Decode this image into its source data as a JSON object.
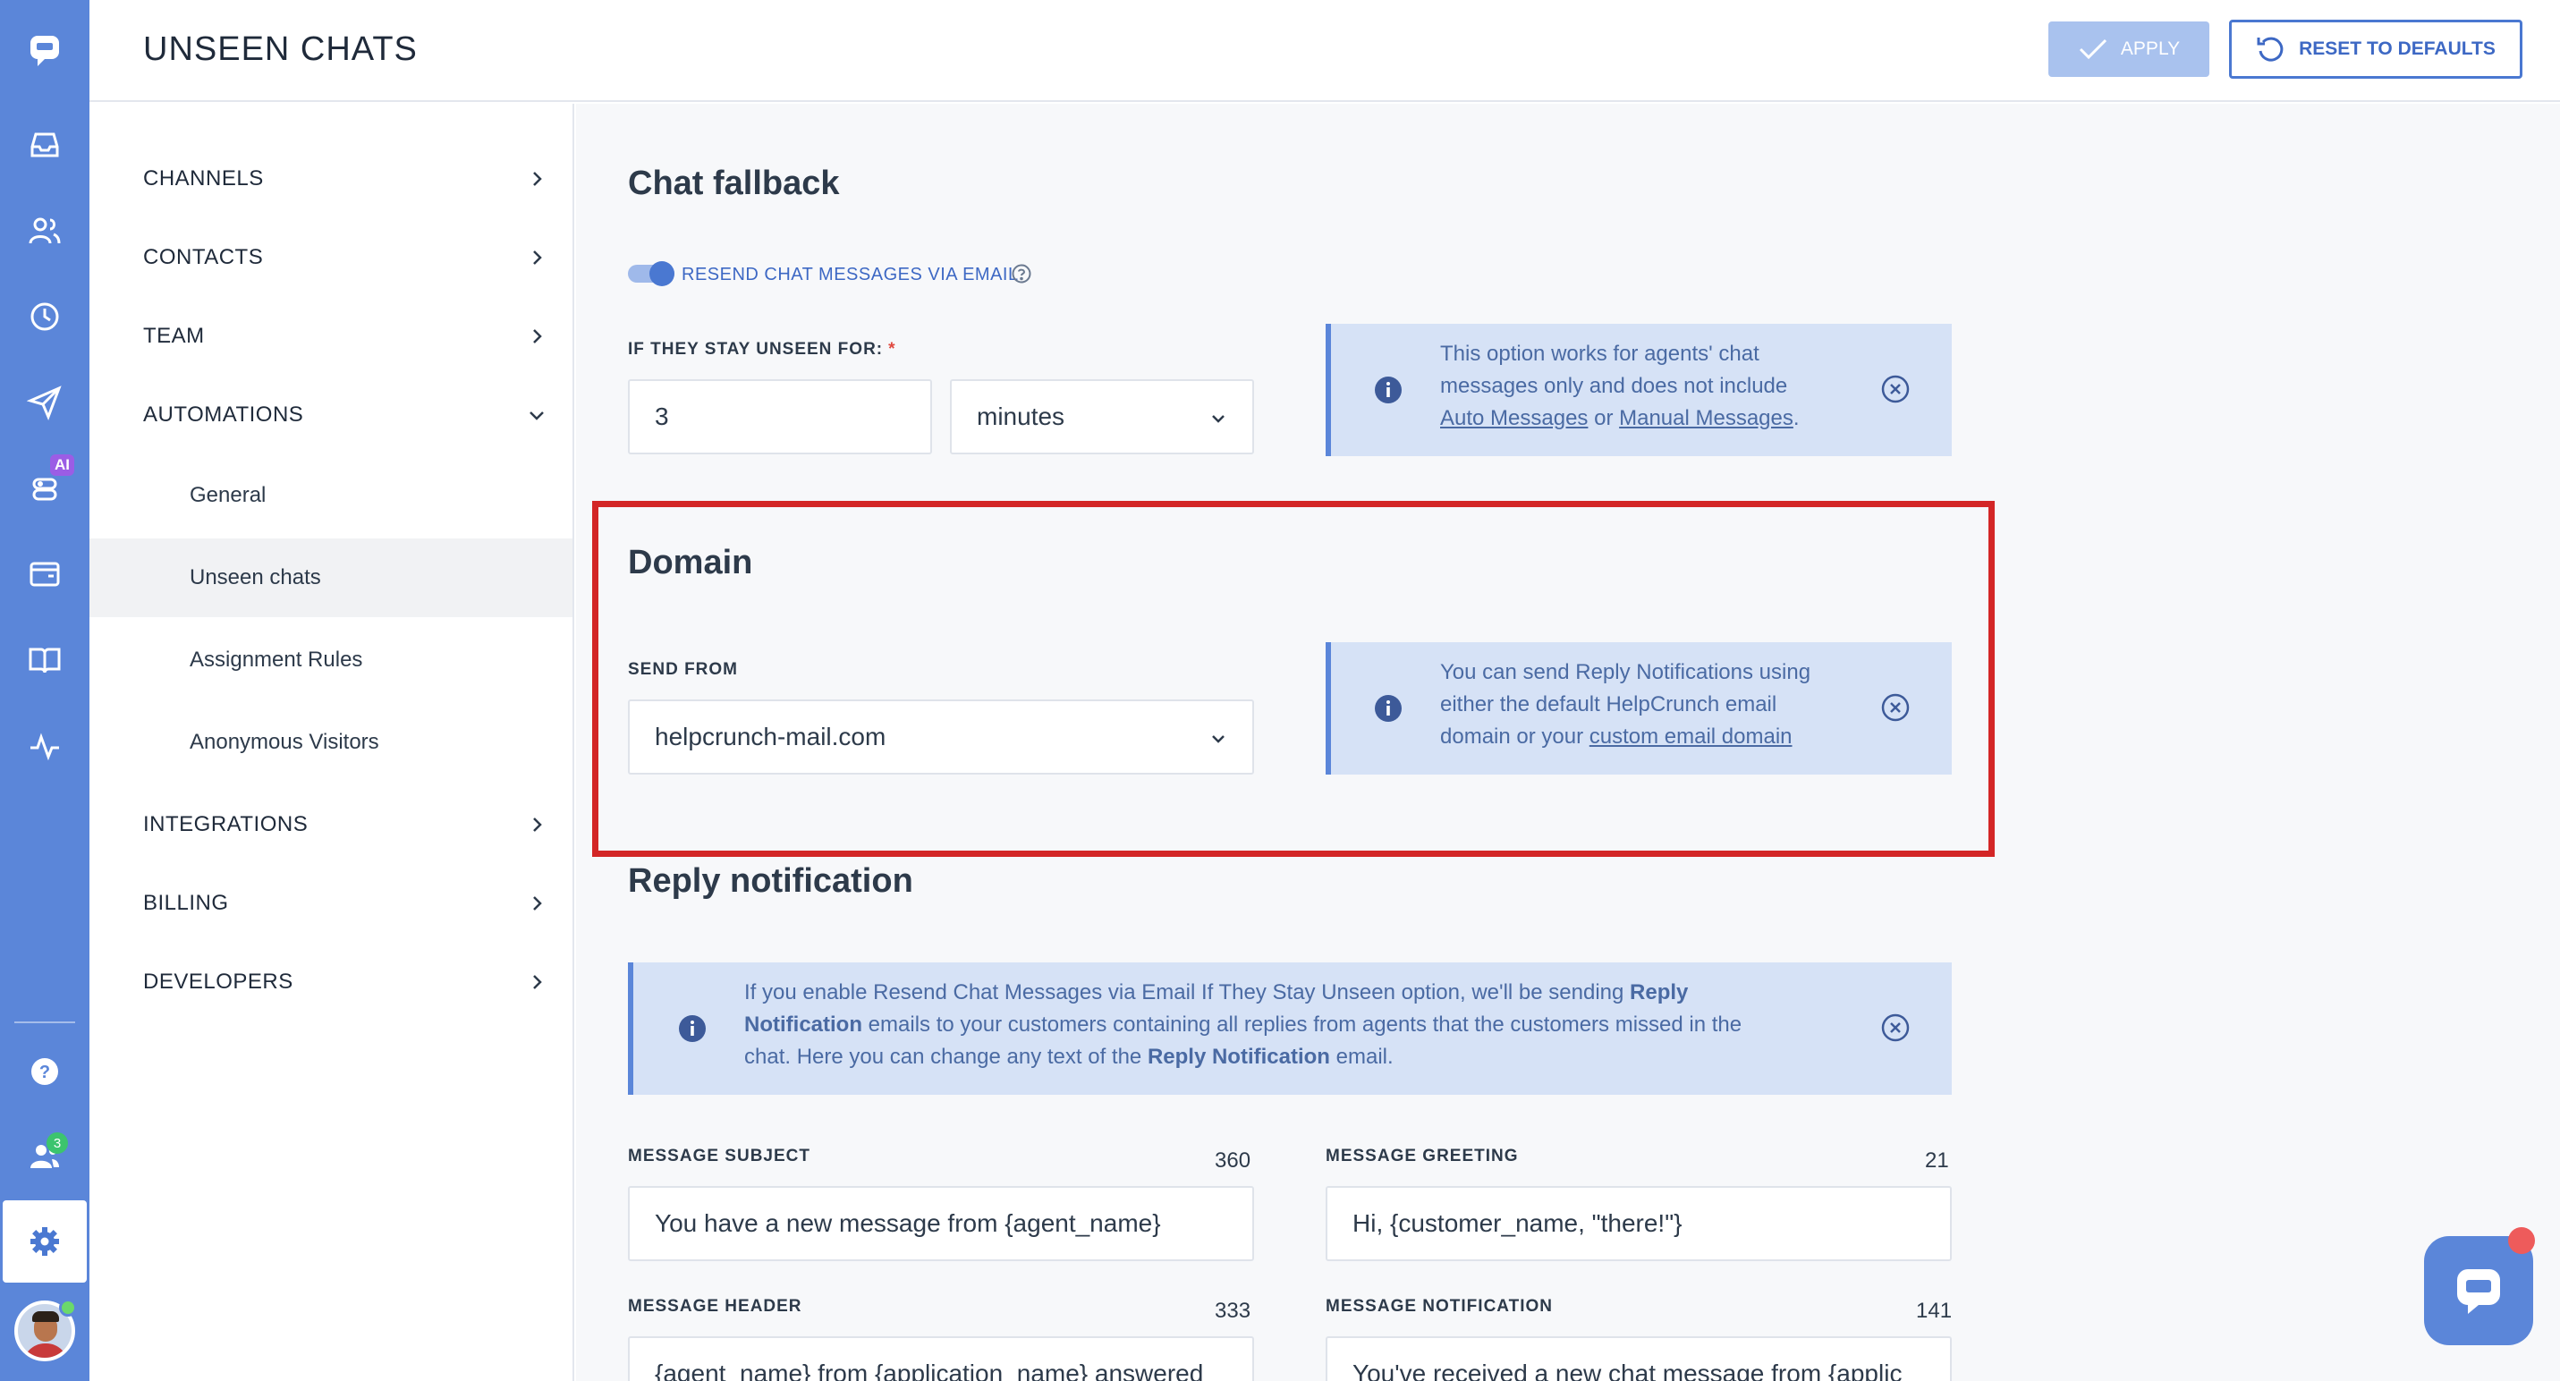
{
  "header": {
    "title": "UNSEEN CHATS",
    "apply_label": "APPLY",
    "reset_label": "RESET TO DEFAULTS"
  },
  "rail": {
    "icons": [
      "chat-logo-icon",
      "inbox-icon",
      "contacts-icon",
      "history-icon",
      "send-icon",
      "ai-bot-icon",
      "knowledge-card-icon",
      "book-icon",
      "activity-icon",
      "help-icon",
      "team-icon",
      "settings-icon"
    ],
    "ai_badge": "AI",
    "team_count": "3"
  },
  "sidebar": {
    "items": [
      {
        "label": "CHANNELS"
      },
      {
        "label": "CONTACTS"
      },
      {
        "label": "TEAM"
      },
      {
        "label": "AUTOMATIONS"
      }
    ],
    "sub_items": [
      {
        "label": "General"
      },
      {
        "label": "Unseen chats"
      },
      {
        "label": "Assignment Rules"
      },
      {
        "label": "Anonymous Visitors"
      }
    ],
    "bottom_items": [
      {
        "label": "INTEGRATIONS"
      },
      {
        "label": "BILLING"
      },
      {
        "label": "DEVELOPERS"
      }
    ]
  },
  "chat_fallback": {
    "heading": "Chat fallback",
    "toggle_label": "RESEND CHAT MESSAGES VIA EMAIL",
    "toggle_on": true,
    "unseen_label": "IF THEY STAY UNSEEN FOR:",
    "required_mark": "*",
    "unseen_value": "3",
    "unit_value": "minutes",
    "info": {
      "text_1": "This option works for agents' chat",
      "text_2": "messages only and does not include",
      "link_auto": "Auto Messages",
      "or": "or",
      "link_manual": "Manual Messages",
      "period": "."
    }
  },
  "domain": {
    "heading": "Domain",
    "send_from_label": "SEND FROM",
    "send_from_value": "helpcrunch-mail.com",
    "info": {
      "text_1": "You can send Reply Notifications using",
      "text_2": "either the default HelpCrunch email",
      "text_3": "domain or your",
      "link": "custom email domain"
    }
  },
  "reply_notification": {
    "heading": "Reply notification",
    "info": {
      "p1": "If you enable Resend Chat Messages via Email If They Stay Unseen option, we'll be sending",
      "b1": "Reply",
      "b1b": "Notification",
      "p2": "emails to your customers containing all replies from agents that the customers missed in the",
      "p3": "chat. Here you can change any text of the",
      "b2": "Reply Notification",
      "p4": "email."
    },
    "fields": {
      "subject_label": "MESSAGE SUBJECT",
      "subject_count": "360",
      "subject_value": "You have a new message from {agent_name}",
      "greeting_label": "MESSAGE GREETING",
      "greeting_count": "21",
      "greeting_value": "Hi, {customer_name, \"there!\"}",
      "header_label": "MESSAGE HEADER",
      "header_count": "333",
      "header_value": "{agent_name} from {application_name} answered",
      "notification_label": "MESSAGE NOTIFICATION",
      "notification_count": "141",
      "notification_value": "You've received a new chat message from {applic"
    }
  },
  "colors": {
    "rail": "#5b86d9",
    "accent": "#4a78d1",
    "info_bg": "#d6e2f6",
    "highlight": "#d32626"
  }
}
